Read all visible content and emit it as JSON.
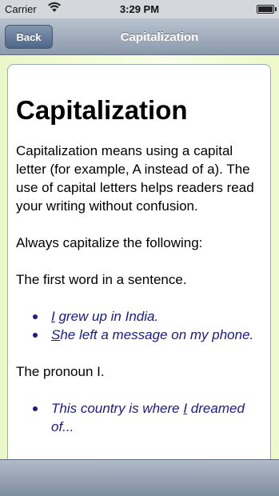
{
  "status_bar": {
    "carrier": "Carrier",
    "time": "3:29 PM",
    "wifi_icon": "wifi-icon",
    "battery_icon": "battery-icon"
  },
  "nav_bar": {
    "back_label": "Back",
    "title": "Capitalization"
  },
  "article": {
    "heading": "Capitalization",
    "intro": "Capitalization means using a capital letter (for example, A instead of a). The use of capital letters helps readers read your writing without confusion.",
    "always": "Always capitalize the following:",
    "rule1": "The first word in a sentence.",
    "examples1": [
      {
        "first": "I",
        "rest": " grew up in India."
      },
      {
        "first": "S",
        "rest": "he left a message on my phone."
      }
    ],
    "rule2": "The pronoun I.",
    "examples2": [
      {
        "before": "This country is where ",
        "first": "I",
        "rest": " dreamed of..."
      }
    ]
  },
  "colors": {
    "example_text": "#1a1a8a",
    "nav_bar": "#8b99ab"
  }
}
